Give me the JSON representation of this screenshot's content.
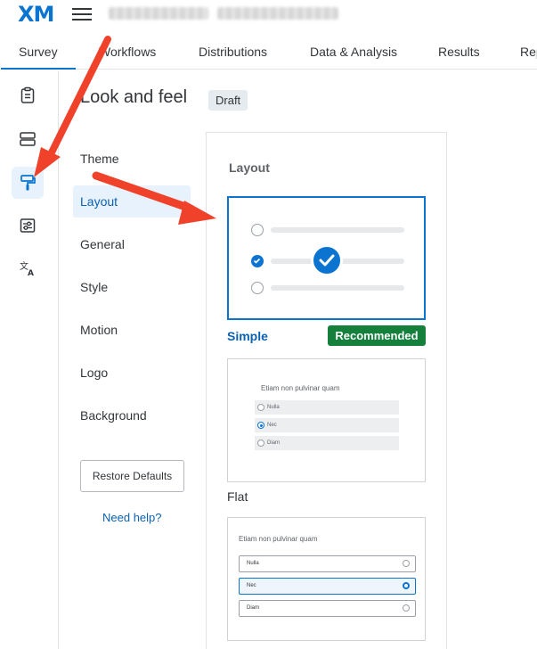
{
  "app": {
    "logo": "XM",
    "tabs": [
      {
        "label": "Survey",
        "active": true
      },
      {
        "label": "Workflows",
        "active": false
      },
      {
        "label": "Distributions",
        "active": false
      },
      {
        "label": "Data & Analysis",
        "active": false
      },
      {
        "label": "Results",
        "active": false
      },
      {
        "label": "Rep",
        "active": false
      }
    ],
    "accent_color": "#0b74d1"
  },
  "left_rail": {
    "icons": [
      "clipboard-icon",
      "layout-blocks-icon",
      "paint-roller-icon",
      "sliders-icon",
      "translate-icon"
    ],
    "active": "paint-roller-icon"
  },
  "header": {
    "title": "Look and feel",
    "status_badge": "Draft"
  },
  "submenu": {
    "items": [
      "Theme",
      "Layout",
      "General",
      "Style",
      "Motion",
      "Logo",
      "Background"
    ],
    "active": "Layout",
    "restore_label": "Restore Defaults",
    "help_label": "Need help?"
  },
  "layout_panel": {
    "title": "Layout",
    "options": [
      {
        "name": "Simple",
        "selected": true,
        "badge": "Recommended"
      },
      {
        "name": "Flat",
        "selected": false
      },
      {
        "name": "",
        "selected": false
      }
    ],
    "flat_preview": {
      "question": "Etiam non pulvinar quam",
      "choices": [
        "Nulla",
        "Nec",
        "Diam"
      ],
      "selected_index": 1
    },
    "classic_preview": {
      "question": "Etiam non pulvinar quam",
      "choices": [
        "Nulla",
        "Nec",
        "Diam"
      ],
      "selected_index": 1
    },
    "recommended_color": "#14803c"
  },
  "annotations": {
    "arrow_color": "#f0412a"
  }
}
